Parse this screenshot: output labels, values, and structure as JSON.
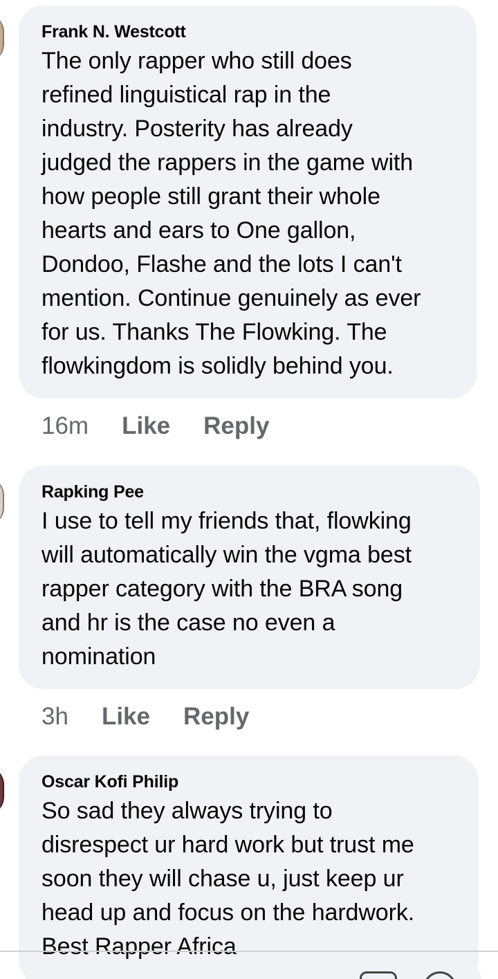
{
  "comments": [
    {
      "author": "Frank N. Westcott",
      "text": "The only rapper who still does\nrefined linguistical rap in the\nindustry. Posterity has already\njudged the rappers in the game with\nhow people still grant their whole\nhearts and ears to One gallon,\nDondoo, Flashe and the lots I can't\nmention. Continue genuinely as ever\nfor us. Thanks The Flowking. The\nflowkingdom is solidly behind you.",
      "time": "16m",
      "like_label": "Like",
      "reply_label": "Reply"
    },
    {
      "author": "Rapking Pee",
      "text": "I use to tell my friends that, flowking\nwill automatically win the vgma best\nrapper category with the BRA song\nand hr is the case no even a\nnomination",
      "time": "3h",
      "like_label": "Like",
      "reply_label": "Reply"
    },
    {
      "author": "Oscar Kofi Philip",
      "text": "So sad they always trying to\ndisrespect ur hard work but trust me\nsoon they will chase u, just keep ur\nhead up and focus on the hardwork.\nBest Rapper Africa"
    }
  ],
  "composer": {
    "icons": [
      "sticker-icon",
      "emoji-icon"
    ]
  },
  "colors": {
    "bubble": "#f0f2f5",
    "text": "#050505",
    "meta": "#65676b"
  }
}
